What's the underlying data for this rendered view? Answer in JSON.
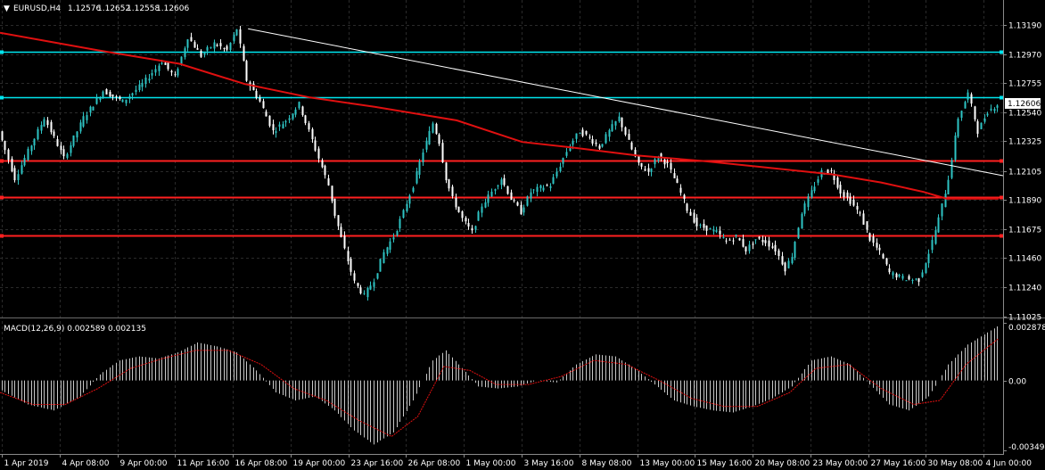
{
  "chart_data": [
    {
      "type": "candlestick",
      "title": "EURUSD,H4",
      "ohlc_header": [
        "1.12576",
        "1.12652",
        "1.12558",
        "1.12606"
      ],
      "current_price": "1.12606",
      "ylim": [
        1.11025,
        1.1334
      ],
      "y_ticks": [
        "1.13190",
        "1.12970",
        "1.12755",
        "1.12540",
        "1.12325",
        "1.12105",
        "1.11890",
        "1.11675",
        "1.11460",
        "1.11240",
        "1.11025"
      ],
      "x_ticks": [
        "1 Apr 2019",
        "4 Apr 08:00",
        "9 Apr 00:00",
        "11 Apr 16:00",
        "16 Apr 08:00",
        "19 Apr 00:00",
        "23 Apr 16:00",
        "26 Apr 08:00",
        "1 May 00:00",
        "3 May 16:00",
        "8 May 08:00",
        "13 May 00:00",
        "15 May 16:00",
        "20 May 08:00",
        "23 May 00:00",
        "27 May 16:00",
        "30 May 08:00",
        "4 Jun 00:00"
      ],
      "price_path": [
        [
          0,
          1.124
        ],
        [
          5,
          1.1205
        ],
        [
          10,
          1.123
        ],
        [
          14,
          1.125
        ],
        [
          20,
          1.122
        ],
        [
          26,
          1.125
        ],
        [
          32,
          1.127
        ],
        [
          38,
          1.1262
        ],
        [
          44,
          1.1275
        ],
        [
          50,
          1.1292
        ],
        [
          54,
          1.128
        ],
        [
          58,
          1.131
        ],
        [
          62,
          1.1296
        ],
        [
          66,
          1.1305
        ],
        [
          70,
          1.13
        ],
        [
          73,
          1.1316
        ],
        [
          76,
          1.1278
        ],
        [
          80,
          1.1262
        ],
        [
          84,
          1.124
        ],
        [
          88,
          1.1248
        ],
        [
          92,
          1.126
        ],
        [
          95,
          1.124
        ],
        [
          98,
          1.122
        ],
        [
          101,
          1.12
        ],
        [
          103,
          1.1178
        ],
        [
          106,
          1.1152
        ],
        [
          109,
          1.1128
        ],
        [
          112,
          1.1118
        ],
        [
          115,
          1.113
        ],
        [
          118,
          1.115
        ],
        [
          121,
          1.1162
        ],
        [
          124,
          1.118
        ],
        [
          127,
          1.12
        ],
        [
          130,
          1.1225
        ],
        [
          133,
          1.1246
        ],
        [
          135,
          1.1232
        ],
        [
          137,
          1.1205
        ],
        [
          139,
          1.119
        ],
        [
          142,
          1.1175
        ],
        [
          145,
          1.1165
        ],
        [
          148,
          1.1185
        ],
        [
          151,
          1.1195
        ],
        [
          154,
          1.1205
        ],
        [
          157,
          1.119
        ],
        [
          160,
          1.118
        ],
        [
          163,
          1.1195
        ],
        [
          166,
          1.1198
        ],
        [
          169,
          1.12
        ],
        [
          172,
          1.1215
        ],
        [
          175,
          1.123
        ],
        [
          178,
          1.124
        ],
        [
          181,
          1.1235
        ],
        [
          184,
          1.1228
        ],
        [
          187,
          1.124
        ],
        [
          190,
          1.125
        ],
        [
          193,
          1.1232
        ],
        [
          196,
          1.1215
        ],
        [
          199,
          1.121
        ],
        [
          202,
          1.1222
        ],
        [
          205,
          1.1215
        ],
        [
          208,
          1.12
        ],
        [
          211,
          1.1182
        ],
        [
          214,
          1.117
        ],
        [
          217,
          1.1168
        ],
        [
          220,
          1.1165
        ],
        [
          223,
          1.1158
        ],
        [
          226,
          1.1162
        ],
        [
          229,
          1.1152
        ],
        [
          232,
          1.116
        ],
        [
          235,
          1.1158
        ],
        [
          238,
          1.1152
        ],
        [
          241,
          1.1138
        ],
        [
          243,
          1.1148
        ],
        [
          246,
          1.118
        ],
        [
          249,
          1.1195
        ],
        [
          252,
          1.121
        ],
        [
          255,
          1.121
        ],
        [
          258,
          1.1195
        ],
        [
          261,
          1.1188
        ],
        [
          264,
          1.1178
        ],
        [
          267,
          1.116
        ],
        [
          270,
          1.115
        ],
        [
          273,
          1.1135
        ],
        [
          276,
          1.1132
        ],
        [
          279,
          1.113
        ],
        [
          282,
          1.113
        ],
        [
          285,
          1.115
        ],
        [
          288,
          1.1175
        ],
        [
          291,
          1.1205
        ],
        [
          294,
          1.125
        ],
        [
          297,
          1.1268
        ],
        [
          300,
          1.124
        ],
        [
          303,
          1.1255
        ],
        [
          306,
          1.126
        ]
      ],
      "moving_average": [
        [
          0,
          1.1313
        ],
        [
          30,
          1.13
        ],
        [
          55,
          1.129
        ],
        [
          75,
          1.1275
        ],
        [
          95,
          1.1265
        ],
        [
          115,
          1.1258
        ],
        [
          140,
          1.1248
        ],
        [
          160,
          1.1232
        ],
        [
          175,
          1.1228
        ],
        [
          195,
          1.1222
        ],
        [
          215,
          1.1218
        ],
        [
          235,
          1.1213
        ],
        [
          255,
          1.1208
        ],
        [
          270,
          1.1202
        ],
        [
          283,
          1.1195
        ],
        [
          290,
          1.119
        ],
        [
          306,
          1.119
        ]
      ],
      "trendline": [
        [
          76,
          1.1316
        ],
        [
          306,
          1.1207
        ]
      ],
      "horizontal_levels": [
        {
          "price": 1.1299,
          "color": "#00e5ee"
        },
        {
          "price": 1.1265,
          "color": "#00e5ee"
        },
        {
          "price": 1.1218,
          "color": "#ff2020"
        },
        {
          "price": 1.1191,
          "color": "#ff2020"
        },
        {
          "price": 1.1163,
          "color": "#ff2020"
        }
      ],
      "colors": {
        "up": "#2ec4c4",
        "down": "#ffffff",
        "ma": "#e01010",
        "trend": "#ffffff",
        "grid": "#2a2a2a"
      }
    },
    {
      "type": "histogram",
      "title": "MACD(12,26,9) 0.002589 0.002135",
      "ylim": [
        -0.003494,
        0.002878
      ],
      "y_ticks": [
        "0.002878",
        "0.00",
        "-0.003494"
      ],
      "macd": [
        [
          0,
          -0.0005
        ],
        [
          8,
          -0.0012
        ],
        [
          16,
          -0.0015
        ],
        [
          24,
          -0.0008
        ],
        [
          30,
          0.0003
        ],
        [
          36,
          0.001
        ],
        [
          42,
          0.0012
        ],
        [
          48,
          0.0011
        ],
        [
          54,
          0.0014
        ],
        [
          60,
          0.0019
        ],
        [
          66,
          0.0017
        ],
        [
          72,
          0.0014
        ],
        [
          78,
          0.0005
        ],
        [
          84,
          -0.0006
        ],
        [
          90,
          -0.001
        ],
        [
          96,
          -0.0008
        ],
        [
          102,
          -0.0015
        ],
        [
          108,
          -0.0025
        ],
        [
          114,
          -0.0032
        ],
        [
          120,
          -0.0026
        ],
        [
          126,
          -0.001
        ],
        [
          132,
          0.001
        ],
        [
          136,
          0.0015
        ],
        [
          140,
          0.0008
        ],
        [
          146,
          -0.0003
        ],
        [
          152,
          -0.0004
        ],
        [
          158,
          -0.0003
        ],
        [
          164,
          0.0
        ],
        [
          170,
          -0.0001
        ],
        [
          176,
          0.0008
        ],
        [
          182,
          0.0013
        ],
        [
          188,
          0.0012
        ],
        [
          194,
          0.0006
        ],
        [
          200,
          -0.0002
        ],
        [
          206,
          -0.001
        ],
        [
          212,
          -0.0013
        ],
        [
          218,
          -0.0015
        ],
        [
          224,
          -0.0016
        ],
        [
          230,
          -0.0013
        ],
        [
          236,
          -0.0009
        ],
        [
          242,
          -0.0003
        ],
        [
          248,
          0.001
        ],
        [
          254,
          0.0012
        ],
        [
          260,
          0.0008
        ],
        [
          266,
          -0.0002
        ],
        [
          272,
          -0.0012
        ],
        [
          278,
          -0.0015
        ],
        [
          284,
          -0.0008
        ],
        [
          290,
          0.0008
        ],
        [
          296,
          0.0018
        ],
        [
          302,
          0.0024
        ],
        [
          306,
          0.0028
        ]
      ],
      "signal": [
        [
          0,
          -0.0006
        ],
        [
          10,
          -0.0012
        ],
        [
          20,
          -0.0012
        ],
        [
          30,
          -0.0004
        ],
        [
          40,
          0.0006
        ],
        [
          50,
          0.0011
        ],
        [
          60,
          0.0015
        ],
        [
          70,
          0.0015
        ],
        [
          80,
          0.0008
        ],
        [
          90,
          -0.0004
        ],
        [
          100,
          -0.001
        ],
        [
          110,
          -0.002
        ],
        [
          120,
          -0.0028
        ],
        [
          128,
          -0.0018
        ],
        [
          136,
          0.0007
        ],
        [
          144,
          0.0005
        ],
        [
          152,
          -0.0002
        ],
        [
          162,
          -0.0002
        ],
        [
          172,
          0.0002
        ],
        [
          182,
          0.001
        ],
        [
          192,
          0.0008
        ],
        [
          202,
          0.0
        ],
        [
          212,
          -0.0009
        ],
        [
          222,
          -0.0013
        ],
        [
          232,
          -0.0013
        ],
        [
          242,
          -0.0006
        ],
        [
          250,
          0.0006
        ],
        [
          260,
          0.0008
        ],
        [
          270,
          -0.0004
        ],
        [
          280,
          -0.0012
        ],
        [
          288,
          -0.001
        ],
        [
          296,
          0.0008
        ],
        [
          306,
          0.0021
        ]
      ],
      "colors": {
        "histogram": "#c8c8c8",
        "signal": "#e01010"
      }
    }
  ]
}
